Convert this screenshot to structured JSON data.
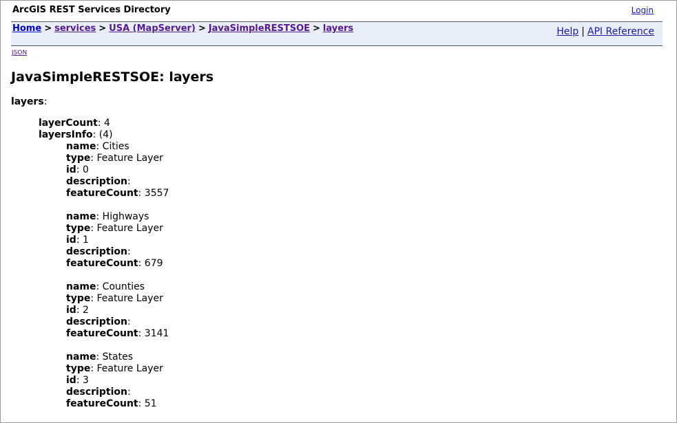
{
  "header": {
    "title": "ArcGIS REST Services Directory",
    "login_label": "Login"
  },
  "breadcrumb": {
    "home": "Home",
    "services": "services",
    "usa": "USA (MapServer)",
    "soe": "JavaSimpleRESTSOE",
    "layers": "layers",
    "separator": ">"
  },
  "help": {
    "help_label": "Help",
    "separator": "|",
    "api_label": "API Reference"
  },
  "json_link": "JSON",
  "page_title": "JavaSimpleRESTSOE: layers",
  "content": {
    "root_key": "layers",
    "layer_count_key": "layerCount",
    "layer_count": "4",
    "layers_info_key": "layersInfo",
    "layers_info_count": "(4)",
    "field_keys": {
      "name": "name",
      "type": "type",
      "id": "id",
      "description": "description",
      "featureCount": "featureCount"
    },
    "layers": [
      {
        "name": "Cities",
        "type": "Feature Layer",
        "id": "0",
        "description": "",
        "featureCount": "3557"
      },
      {
        "name": "Highways",
        "type": "Feature Layer",
        "id": "1",
        "description": "",
        "featureCount": "679"
      },
      {
        "name": "Counties",
        "type": "Feature Layer",
        "id": "2",
        "description": "",
        "featureCount": "3141"
      },
      {
        "name": "States",
        "type": "Feature Layer",
        "id": "3",
        "description": "",
        "featureCount": "51"
      }
    ]
  }
}
